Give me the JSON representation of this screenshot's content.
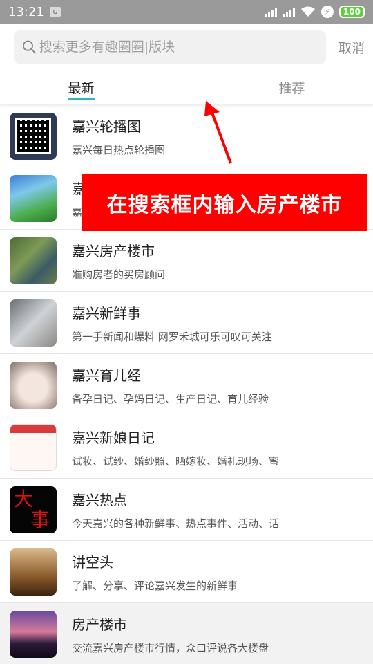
{
  "status_bar": {
    "time": "13:21",
    "notif": "G",
    "battery": "100"
  },
  "search": {
    "placeholder": "搜索更多有趣圈圈|版块",
    "cancel": "取消"
  },
  "tabs": [
    {
      "label": "最新"
    },
    {
      "label": "推荐"
    }
  ],
  "annotation": {
    "text": "在搜索框内输入房产楼市"
  },
  "list": [
    {
      "title": "嘉兴轮播图",
      "desc": "嘉兴每日热点轮播图"
    },
    {
      "title": "嘉",
      "desc": "嘉"
    },
    {
      "title": "嘉兴房产楼市",
      "desc": "准购房者的买房顾问"
    },
    {
      "title": "嘉兴新鲜事",
      "desc": "第一手新闻和爆料 网罗禾城可乐可叹可关注"
    },
    {
      "title": "嘉兴育儿经",
      "desc": "备孕日记、孕妈日记、生产日记、育儿经验"
    },
    {
      "title": "嘉兴新娘日记",
      "desc": "试妆、试纱、婚纱照、晒嫁妆、婚礼现场、蜜"
    },
    {
      "title": "嘉兴热点",
      "desc": "今天嘉兴的各种新鲜事、热点事件、活动、话"
    },
    {
      "title": "讲空头",
      "desc": "了解、分享、评论嘉兴发生的新鲜事"
    },
    {
      "title": "房产楼市",
      "desc": "交流嘉兴房产楼市行情，众口评说各大楼盘"
    }
  ],
  "thumb_text": {
    "da": "大",
    "shi": "事"
  },
  "colors": {
    "accent": "#2cb8b6",
    "annotation": "#ff0000"
  }
}
